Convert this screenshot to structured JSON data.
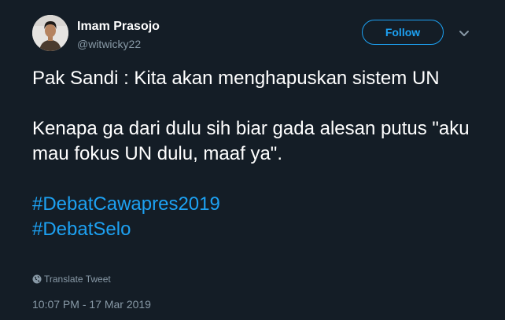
{
  "author": {
    "name": "Imam Prasojo",
    "handle": "@witwicky22"
  },
  "header": {
    "follow_label": "Follow",
    "menu_icon": "chevron-down-icon",
    "avatar_icon": "avatar"
  },
  "tweet": {
    "line1": "Pak Sandi : Kita akan menghapuskan sistem UN",
    "line2": "Kenapa ga dari dulu sih biar gada alesan putus \"aku mau fokus UN dulu, maaf ya\".",
    "hashtags": [
      "#DebatCawapres2019",
      "#DebatSelo"
    ]
  },
  "footer": {
    "translate_label": "Translate Tweet",
    "translate_icon": "globe-icon",
    "timestamp": "10:07 PM - 17 Mar 2019"
  },
  "colors": {
    "background": "#141d26",
    "text": "#ffffff",
    "secondary": "#8899a6",
    "accent": "#1da1f2"
  }
}
